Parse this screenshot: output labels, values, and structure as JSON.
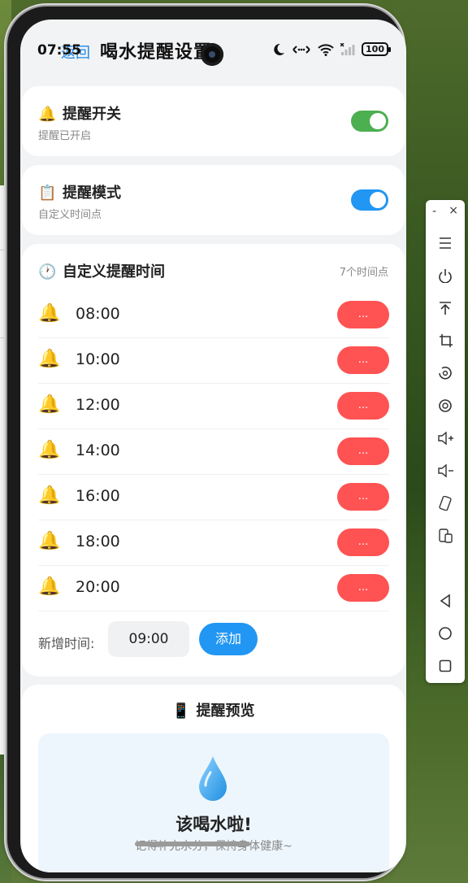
{
  "status": {
    "time": "07:55",
    "battery": "100"
  },
  "header": {
    "back_label": "返回",
    "title": "喝水提醒设置"
  },
  "reminder_switch": {
    "icon": "bell-icon",
    "title": "提醒开关",
    "subtitle": "提醒已开启",
    "enabled": true,
    "toggle_color": "#4caf50"
  },
  "reminder_mode": {
    "icon": "clipboard-icon",
    "title": "提醒模式",
    "subtitle": "自定义时间点",
    "enabled": true,
    "toggle_color": "#2196f3"
  },
  "custom_times": {
    "icon": "clock-icon",
    "title": "自定义提醒时间",
    "count_label": "7个时间点",
    "items": [
      {
        "time": "08:00",
        "action_label": "..."
      },
      {
        "time": "10:00",
        "action_label": "..."
      },
      {
        "time": "12:00",
        "action_label": "..."
      },
      {
        "time": "14:00",
        "action_label": "..."
      },
      {
        "time": "16:00",
        "action_label": "..."
      },
      {
        "time": "18:00",
        "action_label": "..."
      },
      {
        "time": "20:00",
        "action_label": "..."
      }
    ],
    "add_label": "新增时间:",
    "add_value": "09:00",
    "add_button": "添加",
    "action_color": "#ff5252"
  },
  "preview": {
    "icon": "phone-icon",
    "title": "提醒预览",
    "message_title": "该喝水啦!",
    "message_body": "记得补充水分，保持身体健康~"
  },
  "toolbar": {
    "min_label": "-",
    "close_label": "×"
  },
  "colors": {
    "accent": "#2196f3",
    "green": "#4caf50",
    "danger": "#ff5252"
  }
}
